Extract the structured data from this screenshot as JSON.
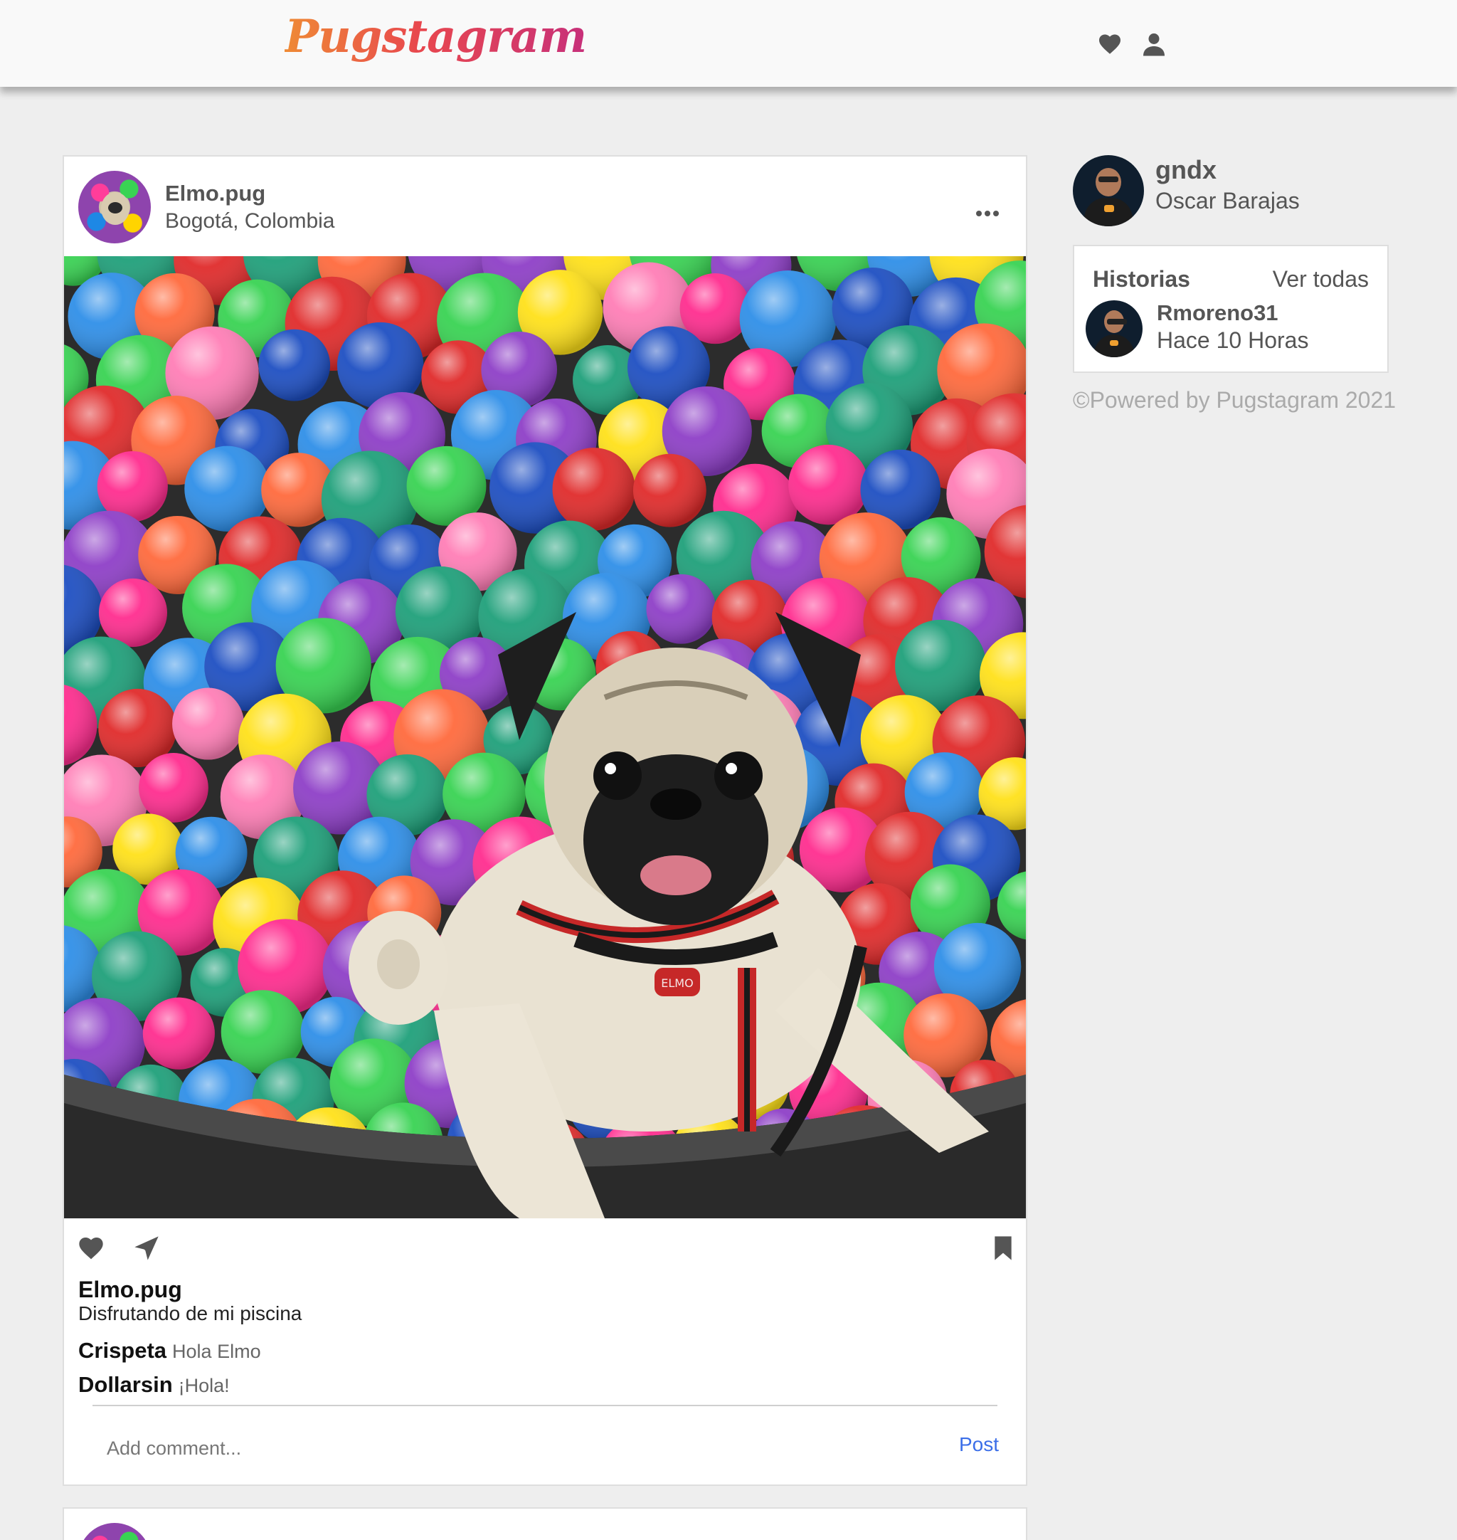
{
  "header": {
    "logo": "Pugstagram",
    "icons": [
      "heart-icon",
      "user-icon"
    ]
  },
  "post": {
    "user": "Elmo.pug",
    "location": "Bogotá, Colombia",
    "caption_user": "Elmo.pug",
    "caption": "Disfrutando de mi piscina",
    "tag_text": "ELMO",
    "comments": [
      {
        "user": "Crispeta",
        "text": "Hola Elmo"
      },
      {
        "user": "Dollarsin",
        "text": "¡Hola!"
      }
    ],
    "add_comment_placeholder": "Add comment...",
    "post_button": "Post"
  },
  "sidebar": {
    "username": "gndx",
    "full_name": "Oscar Barajas",
    "stories_title": "Historias",
    "stories_all": "Ver todas",
    "story": {
      "user": "Rmoreno31",
      "time": "Hace 10 Horas"
    },
    "footer": "©Powered by Pugstagram 2021"
  },
  "colors": {
    "accent_link": "#3b6ee8",
    "logo_gradient_start": "#ef8a35",
    "logo_gradient_end": "#c7307a"
  }
}
